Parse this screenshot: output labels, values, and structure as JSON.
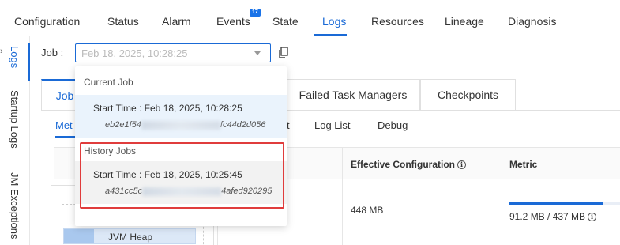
{
  "top_nav": {
    "tabs": [
      {
        "label": "Configuration"
      },
      {
        "label": "Status"
      },
      {
        "label": "Alarm"
      },
      {
        "label": "Events",
        "badge": "17"
      },
      {
        "label": "State"
      },
      {
        "label": "Logs",
        "active": true
      },
      {
        "label": "Resources"
      },
      {
        "label": "Lineage"
      },
      {
        "label": "Diagnosis"
      }
    ]
  },
  "sidebar": {
    "items": [
      {
        "label": "Logs",
        "active": true
      },
      {
        "label": "Startup Logs"
      },
      {
        "label": "JM Exceptions"
      }
    ]
  },
  "job": {
    "label": "Job :",
    "selected_value": "Feb 18, 2025, 10:28:25"
  },
  "sub_tabs": [
    {
      "label": "Job",
      "active": true
    },
    {
      "label": "Failed Task Managers"
    },
    {
      "label": "Checkpoints"
    }
  ],
  "third_tabs": [
    {
      "label": "Met",
      "active": true
    },
    {
      "label": "t"
    },
    {
      "label": "Log List"
    },
    {
      "label": "Debug"
    }
  ],
  "table": {
    "headers": [
      "Effective Configuration",
      "Metric"
    ],
    "row": {
      "effective_config": "448 MB",
      "metric_text": "91.2 MB / 437 MB",
      "metric_fraction": 0.209
    }
  },
  "diagram": {
    "jvm_heap_label": "JVM Heap"
  },
  "dropdown": {
    "current_group_label": "Current Job",
    "current": {
      "start_time": "Start Time : Feb 18, 2025, 10:28:25",
      "id_prefix": "eb2e1f54",
      "id_suffix": "fc44d2d056"
    },
    "history_group_label": "History Jobs",
    "history": {
      "start_time": "Start Time : Feb 18, 2025, 10:25:45",
      "id_prefix": "a431cc5c",
      "id_suffix": "4afed920295"
    }
  },
  "colors": {
    "accent": "#1a6ad6",
    "highlight": "#e03c3c"
  }
}
